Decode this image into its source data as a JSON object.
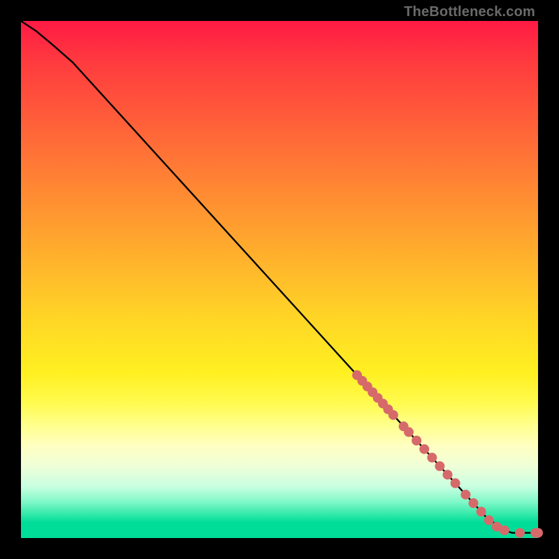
{
  "watermark": "TheBottleneck.com",
  "chart_data": {
    "type": "line",
    "title": "",
    "xlabel": "",
    "ylabel": "",
    "xlim": [
      0,
      100
    ],
    "ylim": [
      0,
      100
    ],
    "grid": false,
    "legend": false,
    "series": [
      {
        "name": "curve",
        "type": "line",
        "color": "#000000",
        "x": [
          0,
          3,
          6,
          10,
          15,
          20,
          25,
          30,
          35,
          40,
          45,
          50,
          55,
          60,
          65,
          70,
          75,
          80,
          85,
          90,
          93.5,
          95,
          97,
          100
        ],
        "y": [
          100,
          98,
          95.5,
          92,
          86.5,
          81,
          75.5,
          70,
          64.5,
          59,
          53.5,
          48,
          42.5,
          37,
          31.5,
          26,
          20.5,
          15,
          9.5,
          4,
          1.5,
          1,
          1,
          1
        ]
      },
      {
        "name": "points",
        "type": "scatter",
        "color": "#d66a6a",
        "x": [
          65,
          66,
          67,
          68,
          69,
          70,
          71,
          72,
          74,
          75,
          76.5,
          78,
          79.5,
          81,
          82.5,
          84,
          86,
          87.5,
          89,
          90.5,
          92,
          93.5,
          96.5,
          99.5,
          100
        ],
        "y": [
          31.5,
          30.4,
          29.3,
          28.2,
          27.1,
          26,
          24.9,
          23.8,
          21.6,
          20.5,
          18.85,
          17.2,
          15.55,
          13.9,
          12.25,
          10.6,
          8.4,
          6.75,
          5.1,
          3.45,
          2.2,
          1.5,
          1,
          1,
          1
        ]
      }
    ]
  }
}
